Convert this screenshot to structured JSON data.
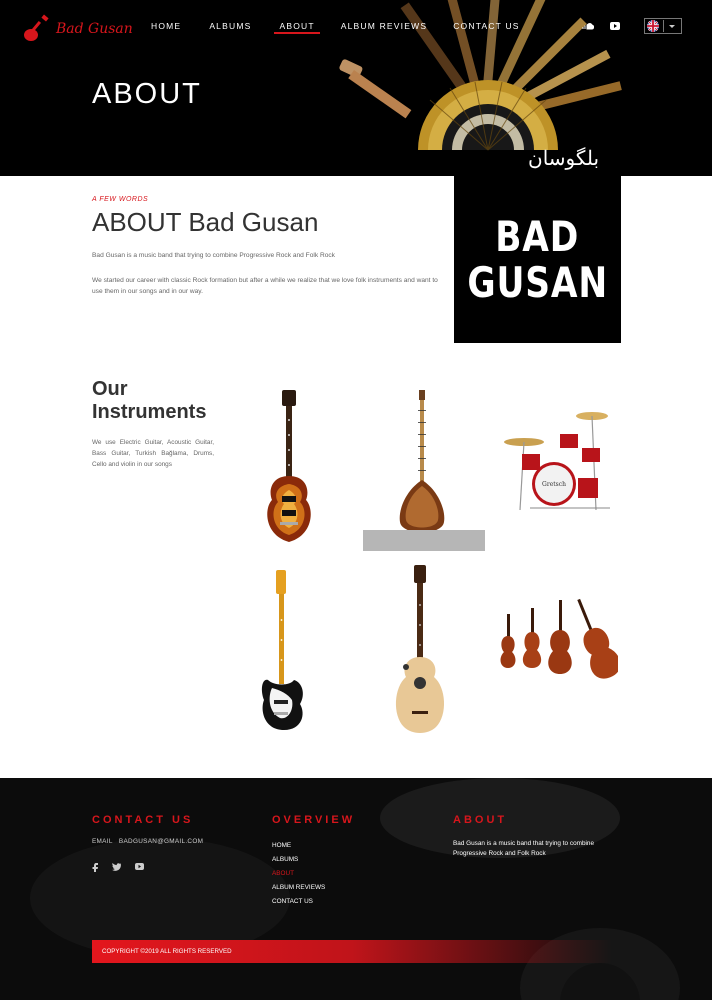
{
  "header": {
    "logo_text": "Bad Gusan",
    "nav": [
      {
        "label": "HOME",
        "active": false
      },
      {
        "label": "ALBUMS",
        "active": false
      },
      {
        "label": "ABOUT",
        "active": true
      },
      {
        "label": "ALBUM REVIEWS",
        "active": false
      },
      {
        "label": "CONTACT US",
        "active": false
      }
    ],
    "social_icons": [
      "soundcloud-icon",
      "youtube-icon"
    ],
    "language_flag": "uk-flag-icon",
    "page_title": "ABOUT",
    "hero_script_text": "بلگوسان"
  },
  "about": {
    "kicker": "A FEW WORDS",
    "title": "ABOUT Bad Gusan",
    "paragraph1": "Bad Gusan is a music band that trying to combine Progressive Rock and Folk Rock",
    "paragraph2": "We started our career with classic Rock formation but after a while we realize that we love folk instruments and want to use them in our songs and in our way.",
    "box_line1": "BAD",
    "box_line2": "GUSAN"
  },
  "instruments": {
    "title_line1": "Our",
    "title_line2": "Instruments",
    "text": "We use Electric Guitar, Acoustic Guitar, Bass Guitar, Turkish Bağlama, Drums, Cello and violin in our songs",
    "items": [
      "electric-guitar",
      "baglama",
      "drum-kit",
      "bass-guitar",
      "acoustic-guitar",
      "violin-family"
    ]
  },
  "footer": {
    "contact_heading": "CONTACT US",
    "email_label": "EMAIL",
    "email_value": "BADGUSAN@GMAIL.COM",
    "social_icons": [
      "facebook-icon",
      "twitter-icon",
      "youtube-icon"
    ],
    "overview_heading": "OVERVIEW",
    "links": [
      {
        "label": "HOME",
        "active": false
      },
      {
        "label": "ALBUMS",
        "active": false
      },
      {
        "label": "ABOUT",
        "active": true
      },
      {
        "label": "ALBUM REVIEWS",
        "active": false
      },
      {
        "label": "CONTACT US",
        "active": false
      }
    ],
    "about_heading": "ABOUT",
    "about_text": "Bad Gusan is a music band that trying to combine Progressive Rock and Folk Rock",
    "copyright": "Copyright ©2019 ALL RIGHTS RESERVED"
  },
  "colors": {
    "accent": "#d7161c",
    "dark": "#000000",
    "footer_bg": "#0c0c0c"
  }
}
